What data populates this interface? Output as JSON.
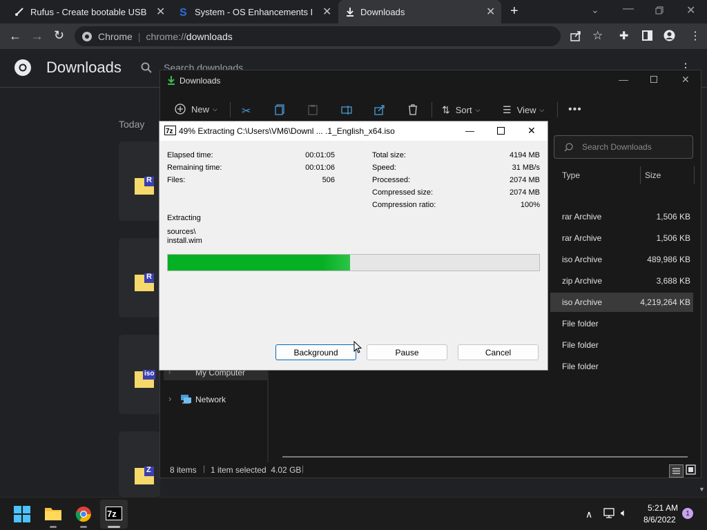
{
  "browser": {
    "tabs": [
      {
        "title": "Rufus - Create bootable USB driv",
        "icon": "rufus-icon"
      },
      {
        "title": "System - OS Enhancements Dow",
        "icon": "softpedia-icon"
      },
      {
        "title": "Downloads",
        "icon": "download-icon"
      }
    ],
    "omnibox": {
      "site": "Chrome",
      "url_prefix": "chrome://",
      "url_path": "downloads"
    }
  },
  "chrome_downloads": {
    "title": "Downloads",
    "search_placeholder": "Search downloads",
    "section": "Today",
    "items": [
      {
        "badge": "R",
        "icon": "rar-icon"
      },
      {
        "badge": "R",
        "icon": "rar-icon"
      },
      {
        "badge": "iso",
        "icon": "iso-icon"
      },
      {
        "badge": "Z",
        "icon": "zip-icon"
      }
    ]
  },
  "explorer": {
    "title": "Downloads",
    "toolbar": {
      "new": "New",
      "sort": "Sort",
      "view": "View"
    },
    "search_placeholder": "Search Downloads",
    "columns": {
      "type": "Type",
      "size": "Size"
    },
    "rows": [
      {
        "type": "rar Archive",
        "size": "1,506 KB"
      },
      {
        "type": "rar Archive",
        "size": "1,506 KB"
      },
      {
        "type": "iso Archive",
        "size": "489,986 KB"
      },
      {
        "type": "zip Archive",
        "size": "3,688 KB"
      },
      {
        "type": "iso Archive",
        "size": "4,219,264 KB"
      },
      {
        "type": "File folder",
        "size": ""
      },
      {
        "type": "File folder",
        "size": ""
      },
      {
        "type": "File folder",
        "size": ""
      }
    ],
    "nav": {
      "my_computer": "My Computer",
      "network": "Network"
    },
    "status": {
      "items": "8 items",
      "selected": "1 item selected  4.02 GB"
    }
  },
  "dialog": {
    "title": "49% Extracting C:\\Users\\VM6\\Downl ... .1_English_x64.iso",
    "left_stats": [
      {
        "label": "Elapsed time:",
        "value": "00:01:05"
      },
      {
        "label": "Remaining time:",
        "value": "00:01:06"
      },
      {
        "label": "Files:",
        "value": "506"
      }
    ],
    "right_stats": [
      {
        "label": "Total size:",
        "value": "4194 MB"
      },
      {
        "label": "Speed:",
        "value": "31 MB/s"
      },
      {
        "label": "Processed:",
        "value": "2074 MB"
      },
      {
        "label": "Compressed size:",
        "value": "2074 MB"
      },
      {
        "label": "Compression ratio:",
        "value": "100%"
      }
    ],
    "operation": "Extracting",
    "path_line1": "sources\\",
    "path_line2": "install.wim",
    "progress_percent": 49,
    "buttons": {
      "background": "Background",
      "pause": "Pause",
      "cancel": "Cancel"
    }
  },
  "taskbar": {
    "time": "5:21 AM",
    "date": "8/6/2022",
    "notification_count": "1",
    "apps": [
      "start-icon",
      "file-explorer-icon",
      "chrome-icon",
      "7zip-icon"
    ]
  },
  "colors": {
    "progress": "#06b025",
    "accent": "#0067c0",
    "badge": "#7b5fc9"
  }
}
